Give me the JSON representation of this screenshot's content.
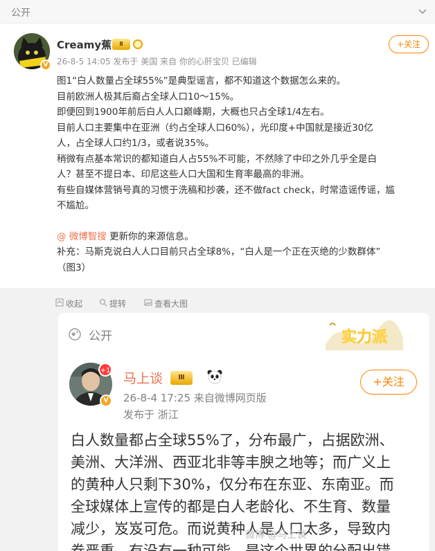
{
  "top": {
    "visibility": "公开",
    "chevron_icon": "chevron-down-icon"
  },
  "post": {
    "username": "Creamy蕉",
    "level": "Ⅱ",
    "verified_badge": "V",
    "meta": "26-8-5 14:05 发布于 美国 来自 你的心肝宝贝 已编辑",
    "follow_label": "+关注",
    "lines": [
      "图1“白人数量占全球55%”是典型谣言，都不知道这个数据怎么来的。",
      "目前欧洲人极其后裔占全球人口10～15%。",
      "即便回到1900年前后白人人口巅峰期，大概也只占全球1/4左右。",
      "目前人口主要集中在亚洲（约占全球人口60%），光印度+中国就是接近30亿",
      "人，占全球人口约1/3，或者说35%。",
      "稍微有点基本常识的都知道白人占55%不可能，不然除了中印之外几乎全是白",
      "人？甚至不提日本、印尼这些人口大国和生育率最高的非洲。",
      "有些自媒体营销号真的习惯于洗稿和抄袭，还不做fact check，时常造谣传谣，尴",
      "不尴尬。"
    ],
    "mention_link": "@ 微博智搜",
    "mention_rest": " 更新你的来源信息。",
    "supplement_lines": [
      "补充：马斯克说白人人口目前只占全球8%，“白人是一个正在灭绝的少数群体”",
      "（图3）"
    ]
  },
  "actions": {
    "collect": "收起",
    "reply": "提转",
    "view": "查看大图"
  },
  "repost": {
    "visibility": "公开",
    "banner_text": "实力派",
    "username": "马上谈",
    "level": "Ⅲ",
    "notification_count": "+1",
    "verified_badge": "V",
    "meta_line1": "26-8-4 17:25  来自微博网页版",
    "meta_line2": "发布于 浙江",
    "follow_label": "+关注",
    "lines": [
      "白人数量都占全球55%了，分布最广，占据欧洲、",
      "美洲、大洋洲、西亚北非等丰腴之地等；而广义上",
      "的黄种人只剩下30%，仅分布在东亚、东南亚。而",
      "全球媒体上宣传的都是白人老龄化、不生育、数量",
      "减少，岌岌可危。而说黄种人是人口太多，导致内",
      "卷严重，有没有一种可能，是这个世界的分配出错"
    ],
    "watermark": "微博 @马上谈"
  },
  "colors": {
    "accent": "#ff8200",
    "link": "#eb7350",
    "meta": "#939393"
  }
}
